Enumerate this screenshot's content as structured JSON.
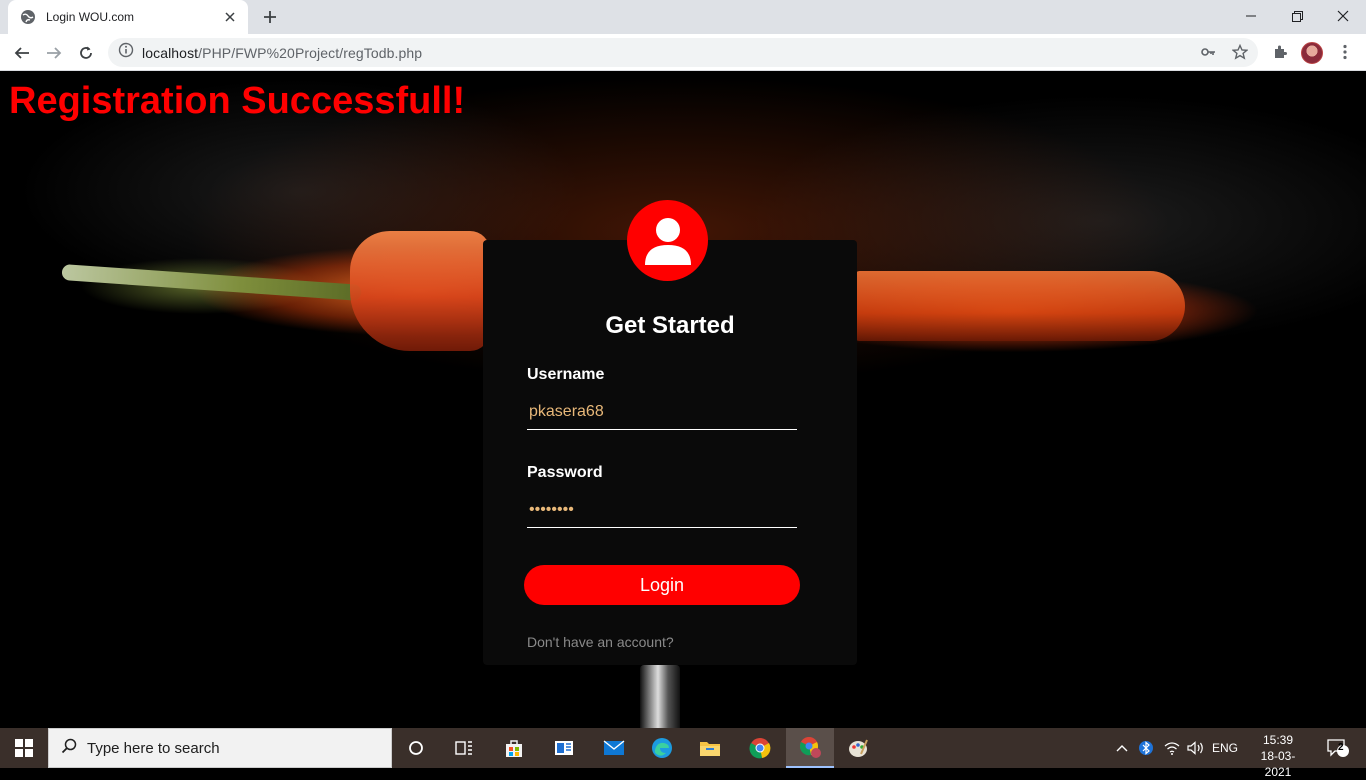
{
  "browser": {
    "tab_title": "Login WOU.com",
    "url_host": "localhost",
    "url_path": "/PHP/FWP%20Project/regTodb.php"
  },
  "page": {
    "status_message": "Registration Successfull!",
    "colors": {
      "accent": "#ff0000",
      "card_bg": "#0a0a0a",
      "input_text": "#e8b879"
    },
    "login_card": {
      "title": "Get Started",
      "username_label": "Username",
      "username_value": "pkasera68",
      "password_label": "Password",
      "password_value": "••••••••",
      "login_button": "Login",
      "signup_link": "Don't have an account?"
    }
  },
  "taskbar": {
    "search_placeholder": "Type here to search",
    "language": "ENG",
    "time": "15:39",
    "date": "18-03-2021",
    "notification_count": "2"
  }
}
